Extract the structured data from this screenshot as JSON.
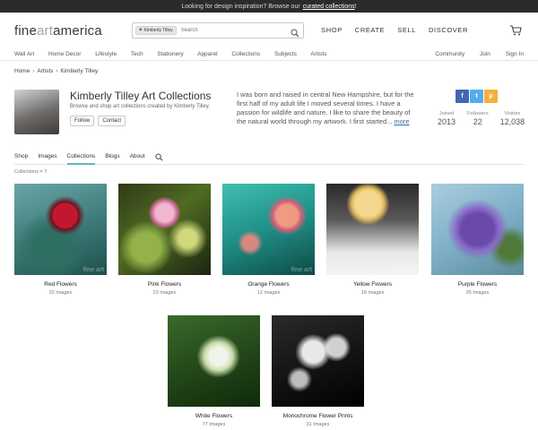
{
  "topbar": {
    "text": "Looking for design inspiration?  Browse our",
    "link": "curated collections",
    "suffix": "!"
  },
  "logo": {
    "part1": "fine",
    "part2": "art",
    "part3": "america"
  },
  "search": {
    "chip": "Kimberly Tilley",
    "placeholder": "Search"
  },
  "mainnav": [
    "SHOP",
    "CREATE",
    "SELL",
    "DISCOVER"
  ],
  "subnav": {
    "left": [
      "Wall Art",
      "Home Decor",
      "Lifestyle",
      "Tech",
      "Stationery",
      "Apparel",
      "Collections",
      "Subjects",
      "Artists"
    ],
    "right": [
      "Community",
      "Join",
      "Sign In"
    ]
  },
  "breadcrumb": [
    "Home",
    "Artists",
    "Kimberly Tilley"
  ],
  "profile": {
    "title": "Kimberly Tilley Art Collections",
    "subtitle": "Browse and shop art collections created by Kimberly Tilley.",
    "follow": "Follow",
    "contact": "Contact",
    "bio": "I was born and raised in central New Hampshire, but for the first half of my adult life I moved several times.  I have a passion for wildlife and nature.   I like to share the beauty of the natural world through my artwork.   I first started...",
    "more": "more"
  },
  "social": [
    "f",
    "t",
    "p"
  ],
  "colors": {
    "facebook": "#4267b2",
    "twitter": "#55acee",
    "pinterest": "#f2b13a",
    "accent": "#5cb8c6"
  },
  "stats": [
    {
      "label": "Joined",
      "value": "2013"
    },
    {
      "label": "Followers",
      "value": "22"
    },
    {
      "label": "Visitors",
      "value": "12,038"
    }
  ],
  "tabs": [
    "Shop",
    "Images",
    "Collections",
    "Blogs",
    "About"
  ],
  "collection_count": "Collections = 7",
  "collections": [
    {
      "name": "Red Flowers",
      "count": "32 Images"
    },
    {
      "name": "Pink Flowers",
      "count": "23 Images"
    },
    {
      "name": "Orange Flowers",
      "count": "12 Images"
    },
    {
      "name": "Yellow Flowers",
      "count": "18 Images"
    },
    {
      "name": "Purple Flowers",
      "count": "35 Images"
    },
    {
      "name": "White Flowers",
      "count": "77 Images"
    },
    {
      "name": "Monochrome Flower Prints",
      "count": "31 Images"
    }
  ]
}
